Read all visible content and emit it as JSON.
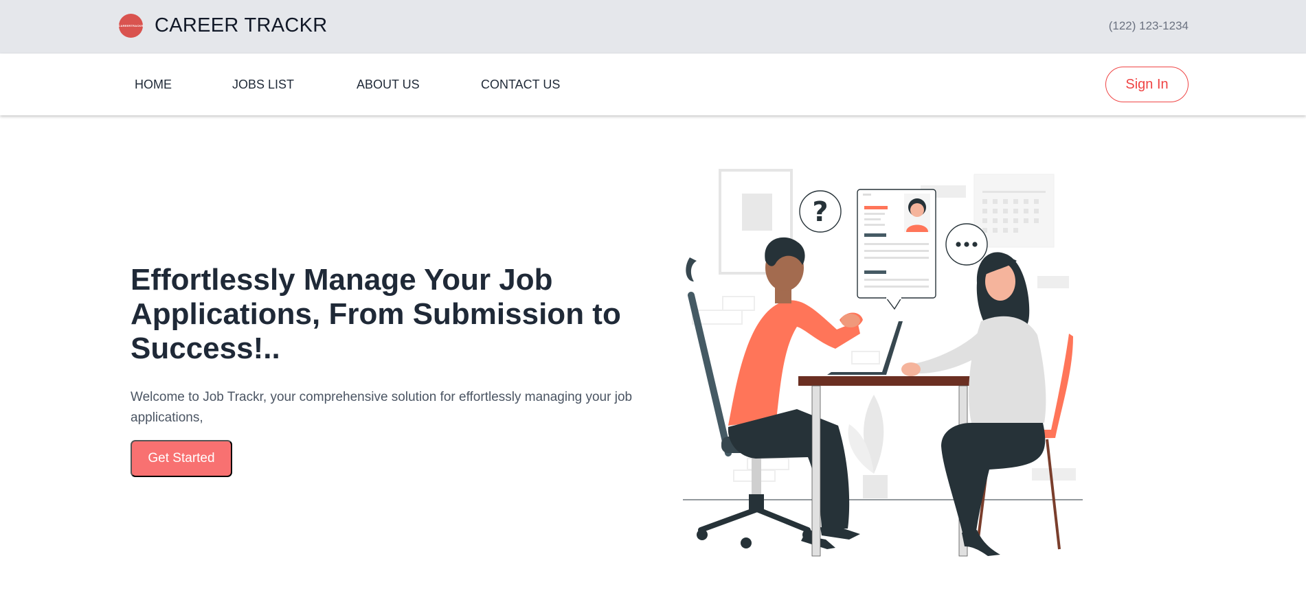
{
  "topbar": {
    "logo_text": "CAREERTRACKR",
    "brand": "CAREER TRACKR",
    "phone": "(122) 123-1234"
  },
  "nav": {
    "items": [
      {
        "label": "HOME"
      },
      {
        "label": "JOBS LIST"
      },
      {
        "label": "ABOUT US"
      },
      {
        "label": "CONTACT US"
      }
    ],
    "signin_label": "Sign In"
  },
  "hero": {
    "title": "Effortlessly Manage Your Job Applications, From Submission to Success!..",
    "description": "Welcome to Job Trackr, your comprehensive solution for effortlessly managing your job applications,",
    "cta_label": "Get Started",
    "illustration_icon": "job-interview-illustration"
  },
  "colors": {
    "accent": "#ef4444",
    "button": "#f87171",
    "topbar": "#e5e7eb",
    "illustration_primary": "#ff7559",
    "illustration_dark": "#263238"
  }
}
